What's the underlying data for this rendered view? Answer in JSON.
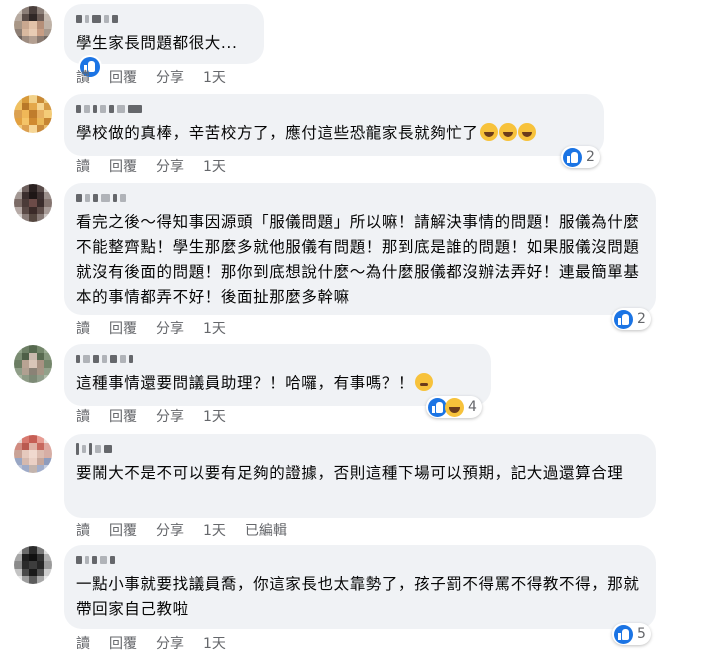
{
  "actions": {
    "read": "讀",
    "reply": "回覆",
    "share": "分享",
    "edited": "已編輯"
  },
  "comments": [
    {
      "text": "學生家長問題都很大...",
      "time": "1天",
      "reaction_count": ""
    },
    {
      "text": "學校做的真棒，辛苦校方了，應付這些恐龍家長就夠忙了",
      "time": "1天",
      "reaction_count": "2"
    },
    {
      "text": "看完之後～得知事因源頭「服儀問題」所以嘛！請解決事情的問題！服儀為什麼不能整齊點！學生那麼多就他服儀有問題！那到底是誰的問題！如果服儀沒問題就沒有後面的問題！那你到底想說什麼～為什麼服儀都沒辦法弄好！連最簡單基本的事情都弄不好！後面扯那麼多幹嘛",
      "time": "1天",
      "reaction_count": "2"
    },
    {
      "text": "這種事情還要問議員助理？！哈囉，有事嗎？！",
      "time": "1天",
      "reaction_count": "4"
    },
    {
      "text": "要鬧大不是不可以要有足夠的證據，否則這種下場可以預期，記大過還算合理",
      "time": "1天",
      "reaction_count": ""
    },
    {
      "text": "一點小事就要找議員喬，你這家長也太靠勢了，孩子罰不得罵不得教不得，那就帶回家自己教啦",
      "time": "1天",
      "reaction_count": "5"
    }
  ]
}
